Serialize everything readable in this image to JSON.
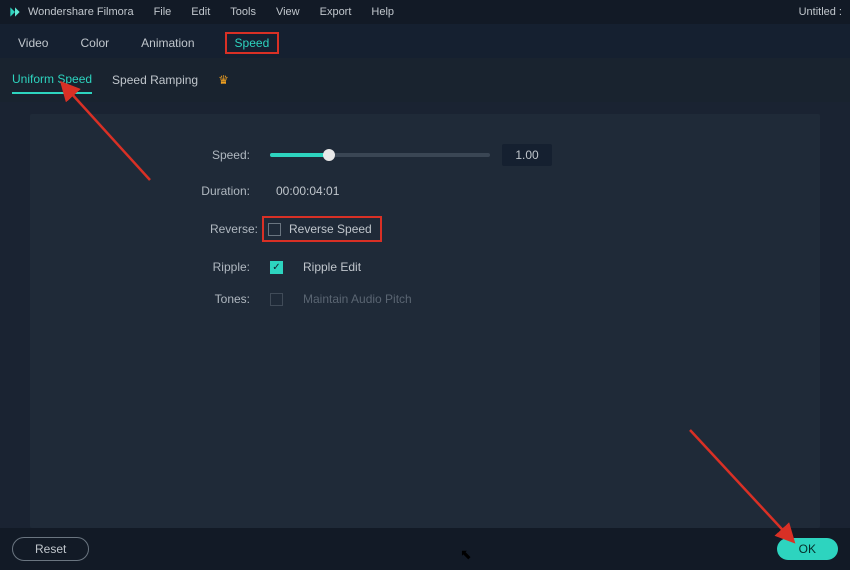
{
  "app": {
    "title": "Wondershare Filmora",
    "file_status": "Untitled :"
  },
  "menu": {
    "file": "File",
    "edit": "Edit",
    "tools": "Tools",
    "view": "View",
    "export": "Export",
    "help": "Help"
  },
  "categories": {
    "video": "Video",
    "color": "Color",
    "animation": "Animation",
    "speed": "Speed"
  },
  "subtabs": {
    "uniform": "Uniform Speed",
    "ramping": "Speed Ramping"
  },
  "form": {
    "speed_label": "Speed:",
    "speed_value": "1.00",
    "duration_label": "Duration:",
    "duration_value": "00:00:04:01",
    "reverse_label": "Reverse:",
    "reverse_check": "Reverse Speed",
    "ripple_label": "Ripple:",
    "ripple_check": "Ripple Edit",
    "tones_label": "Tones:",
    "tones_check": "Maintain Audio Pitch"
  },
  "footer": {
    "reset": "Reset",
    "ok": "OK"
  }
}
